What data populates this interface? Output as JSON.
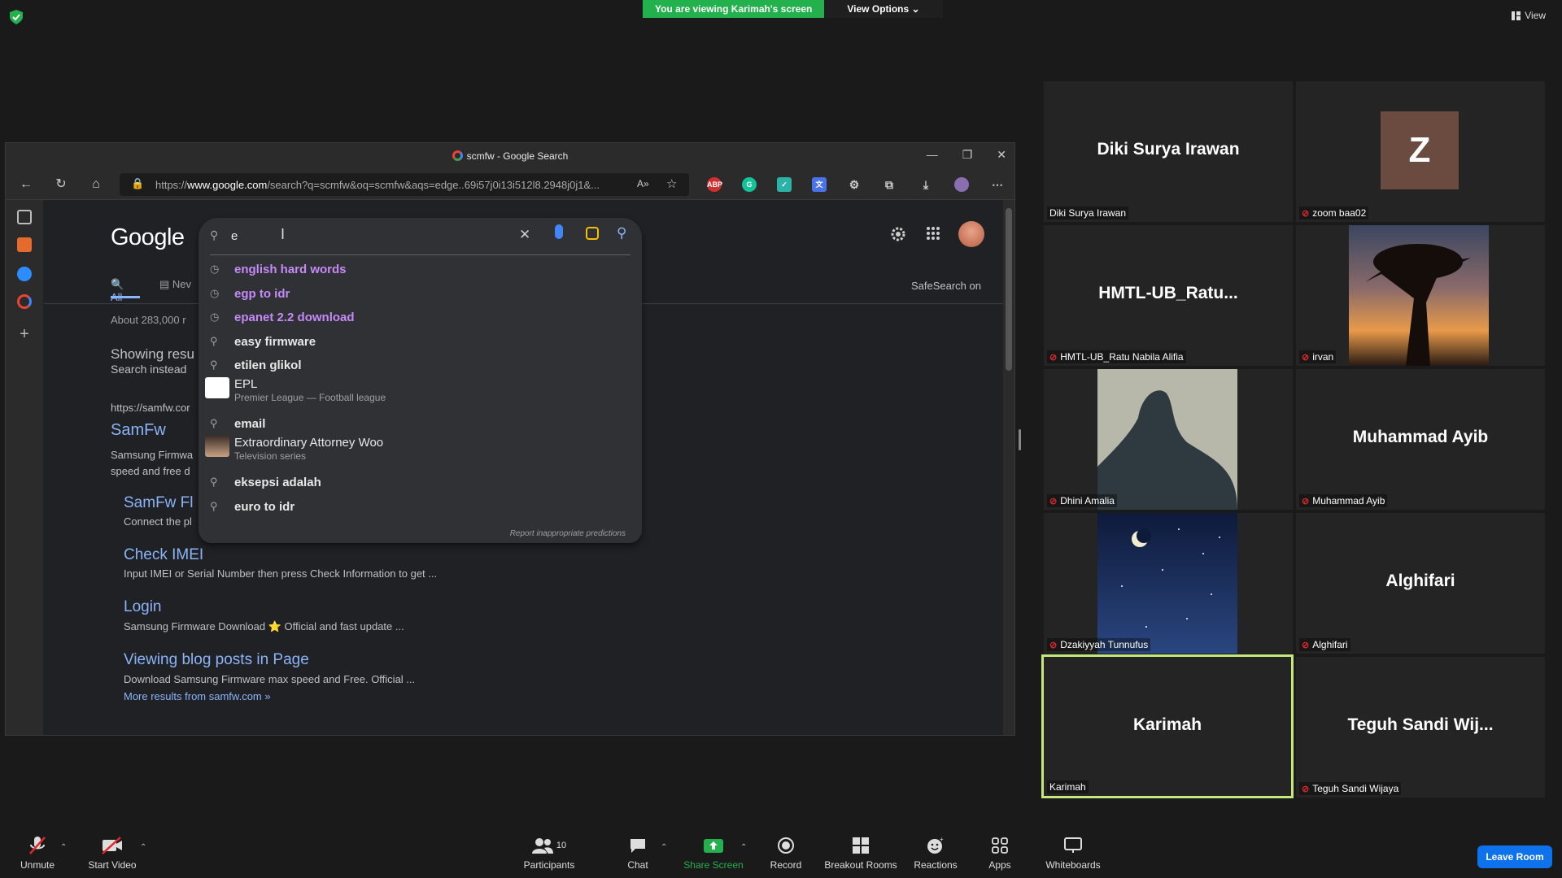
{
  "zoom_top": {
    "viewing_label": "You are viewing Karimah's screen",
    "view_options": "View Options",
    "view": "View"
  },
  "browser": {
    "tab_title": "scmfw - Google Search",
    "url_prefix": "https://",
    "url_host": "www.google.com",
    "url_rest": "/search?q=scmfw&oq=scmfw&aqs=edge..69i57j0i13i512l8.2948j0j1&..."
  },
  "google": {
    "logo": "Google",
    "query": "e",
    "suggestions": [
      {
        "text": "english hard words",
        "kind": "history"
      },
      {
        "text": "egp to idr",
        "kind": "history"
      },
      {
        "text": "epanet 2.2 download",
        "kind": "history"
      },
      {
        "text": "easy firmware",
        "kind": "search"
      },
      {
        "text": "etilen glikol",
        "kind": "search"
      },
      {
        "text": "EPL",
        "kind": "entity",
        "sub": "Premier League — Football league"
      },
      {
        "text": "email",
        "kind": "search"
      },
      {
        "text": "Extraordinary Attorney Woo",
        "kind": "entity",
        "sub": "Television series"
      },
      {
        "text": "eksepsi adalah",
        "kind": "search"
      },
      {
        "text": "euro to idr",
        "kind": "search"
      }
    ],
    "report": "Report inappropriate predictions",
    "tab_all": "All",
    "tab_news": "Nev",
    "safesearch": "SafeSearch on",
    "about": "About 283,000 r",
    "showing": "Showing resu",
    "search_instead": "Search instead",
    "result_url": "https://samfw.cor",
    "result_title": "SamFw",
    "result_snip1": "Samsung Firmwa",
    "result_snip2": "speed and free d",
    "sublinks": [
      {
        "title": "SamFw Fl",
        "snip": "Connect the pl"
      },
      {
        "title": "Check IMEI",
        "snip": "Input IMEI or Serial Number then press Check Information to get ..."
      },
      {
        "title": "Login",
        "snip": "Samsung Firmware Download ⭐ Official and fast update ..."
      },
      {
        "title": "Viewing blog posts in Page",
        "snip": "Download Samsung Firmware max speed and Free. Official ..."
      }
    ],
    "more_results": "More results from samfw.com »"
  },
  "gallery": [
    {
      "big": "Diki Surya Irawan",
      "cap": "Diki Surya Irawan",
      "muted": false,
      "kind": "name"
    },
    {
      "big": "Z",
      "cap": "zoom baa02",
      "muted": true,
      "kind": "avatar"
    },
    {
      "big": "HMTL-UB_Ratu...",
      "cap": "HMTL-UB_Ratu Nabila Alifia",
      "muted": true,
      "kind": "name"
    },
    {
      "big": "",
      "cap": "irvan",
      "muted": true,
      "kind": "photo-sunset"
    },
    {
      "big": "",
      "cap": "Dhini Amalia",
      "muted": true,
      "kind": "photo-shadow"
    },
    {
      "big": "Muhammad Ayib",
      "cap": "Muhammad Ayib",
      "muted": true,
      "kind": "name"
    },
    {
      "big": "",
      "cap": "Dzakiyyah Tunnufus",
      "muted": true,
      "kind": "photo-night"
    },
    {
      "big": "Alghifari",
      "cap": "Alghifari",
      "muted": true,
      "kind": "name"
    },
    {
      "big": "Karimah",
      "cap": "Karimah",
      "muted": false,
      "kind": "name",
      "active": true
    },
    {
      "big": "Teguh Sandi Wij...",
      "cap": "Teguh Sandi Wijaya",
      "muted": true,
      "kind": "name"
    }
  ],
  "bottom": {
    "unmute": "Unmute",
    "start_video": "Start Video",
    "participants": "Participants",
    "participants_count": "10",
    "chat": "Chat",
    "share_screen": "Share Screen",
    "record": "Record",
    "breakout": "Breakout Rooms",
    "reactions": "Reactions",
    "apps": "Apps",
    "whiteboards": "Whiteboards",
    "leave": "Leave Room"
  },
  "colors": {
    "share_green": "#22b14c",
    "active_border": "#c5e87a",
    "leave_blue": "#0e72ed",
    "link_blue": "#8ab4f8",
    "history_purple": "#c58af9"
  }
}
